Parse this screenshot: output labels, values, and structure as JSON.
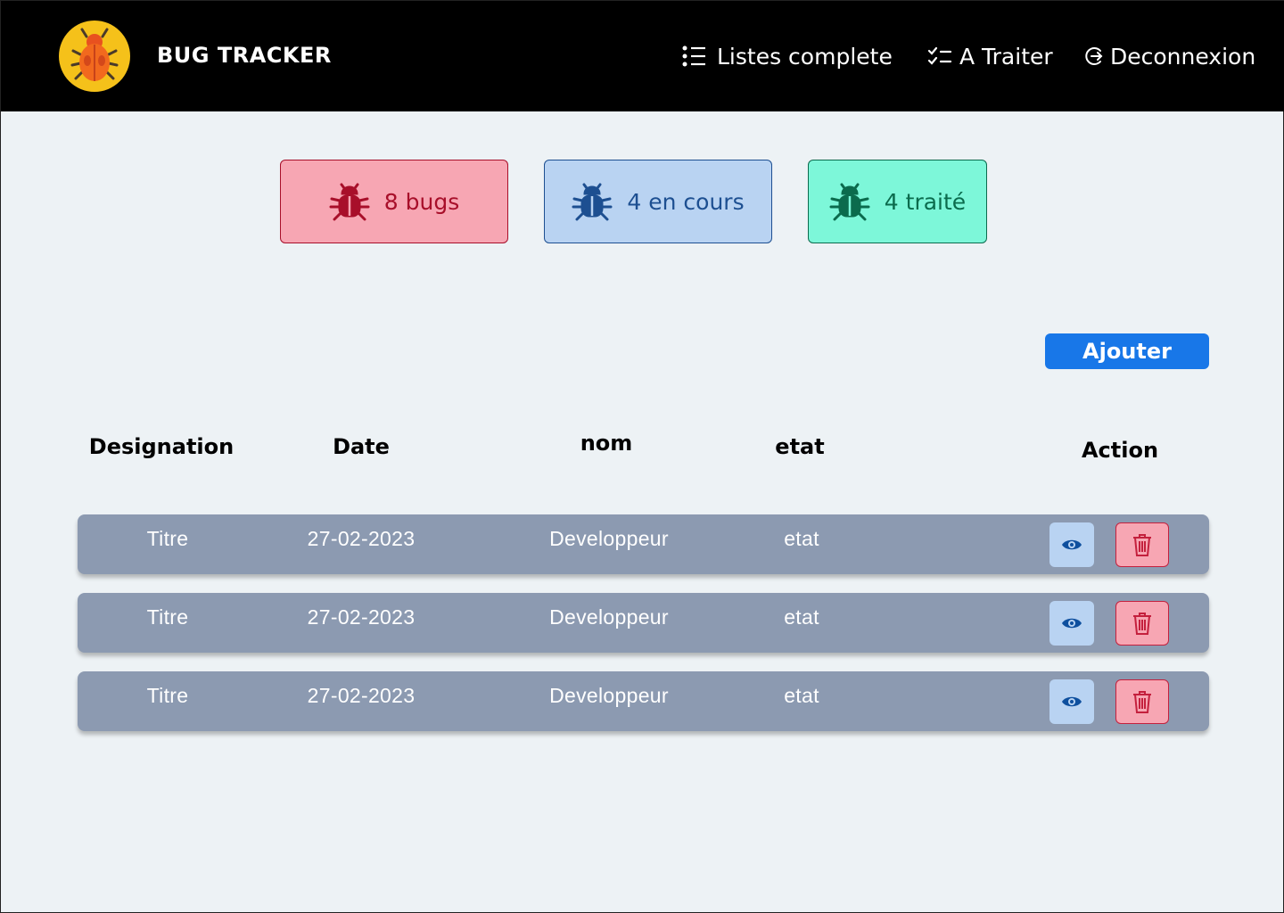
{
  "header": {
    "title": "BUG TRACKER",
    "logo_icon": "bug-logo-icon",
    "nav": [
      {
        "label": "Listes complete",
        "icon": "list-icon"
      },
      {
        "label": "A Traiter",
        "icon": "checklist-icon"
      },
      {
        "label": "Deconnexion",
        "icon": "logout-icon"
      }
    ]
  },
  "stats": [
    {
      "label": "8 bugs",
      "icon": "bug-icon",
      "color": "#a80f2a",
      "background": "#f7a6b3"
    },
    {
      "label": "4 en cours",
      "icon": "bug-icon",
      "color": "#1d4f91",
      "background": "#b9d3f2"
    },
    {
      "label": "4 traité",
      "icon": "bug-icon",
      "color": "#0b6b4d",
      "background": "#7df7d9"
    }
  ],
  "actions": {
    "add_label": "Ajouter",
    "add_color": "#1877e8"
  },
  "table": {
    "headers": [
      "Designation",
      "Date",
      "nom",
      "etat",
      "Action"
    ],
    "rows": [
      {
        "designation": "Titre",
        "date": "27-02-2023",
        "nom": "Developpeur",
        "etat": "etat"
      },
      {
        "designation": "Titre",
        "date": "27-02-2023",
        "nom": "Developpeur",
        "etat": "etat"
      },
      {
        "designation": "Titre",
        "date": "27-02-2023",
        "nom": "Developpeur",
        "etat": "etat"
      }
    ],
    "row_actions": {
      "view_icon": "eye-icon",
      "delete_icon": "trash-icon"
    }
  }
}
